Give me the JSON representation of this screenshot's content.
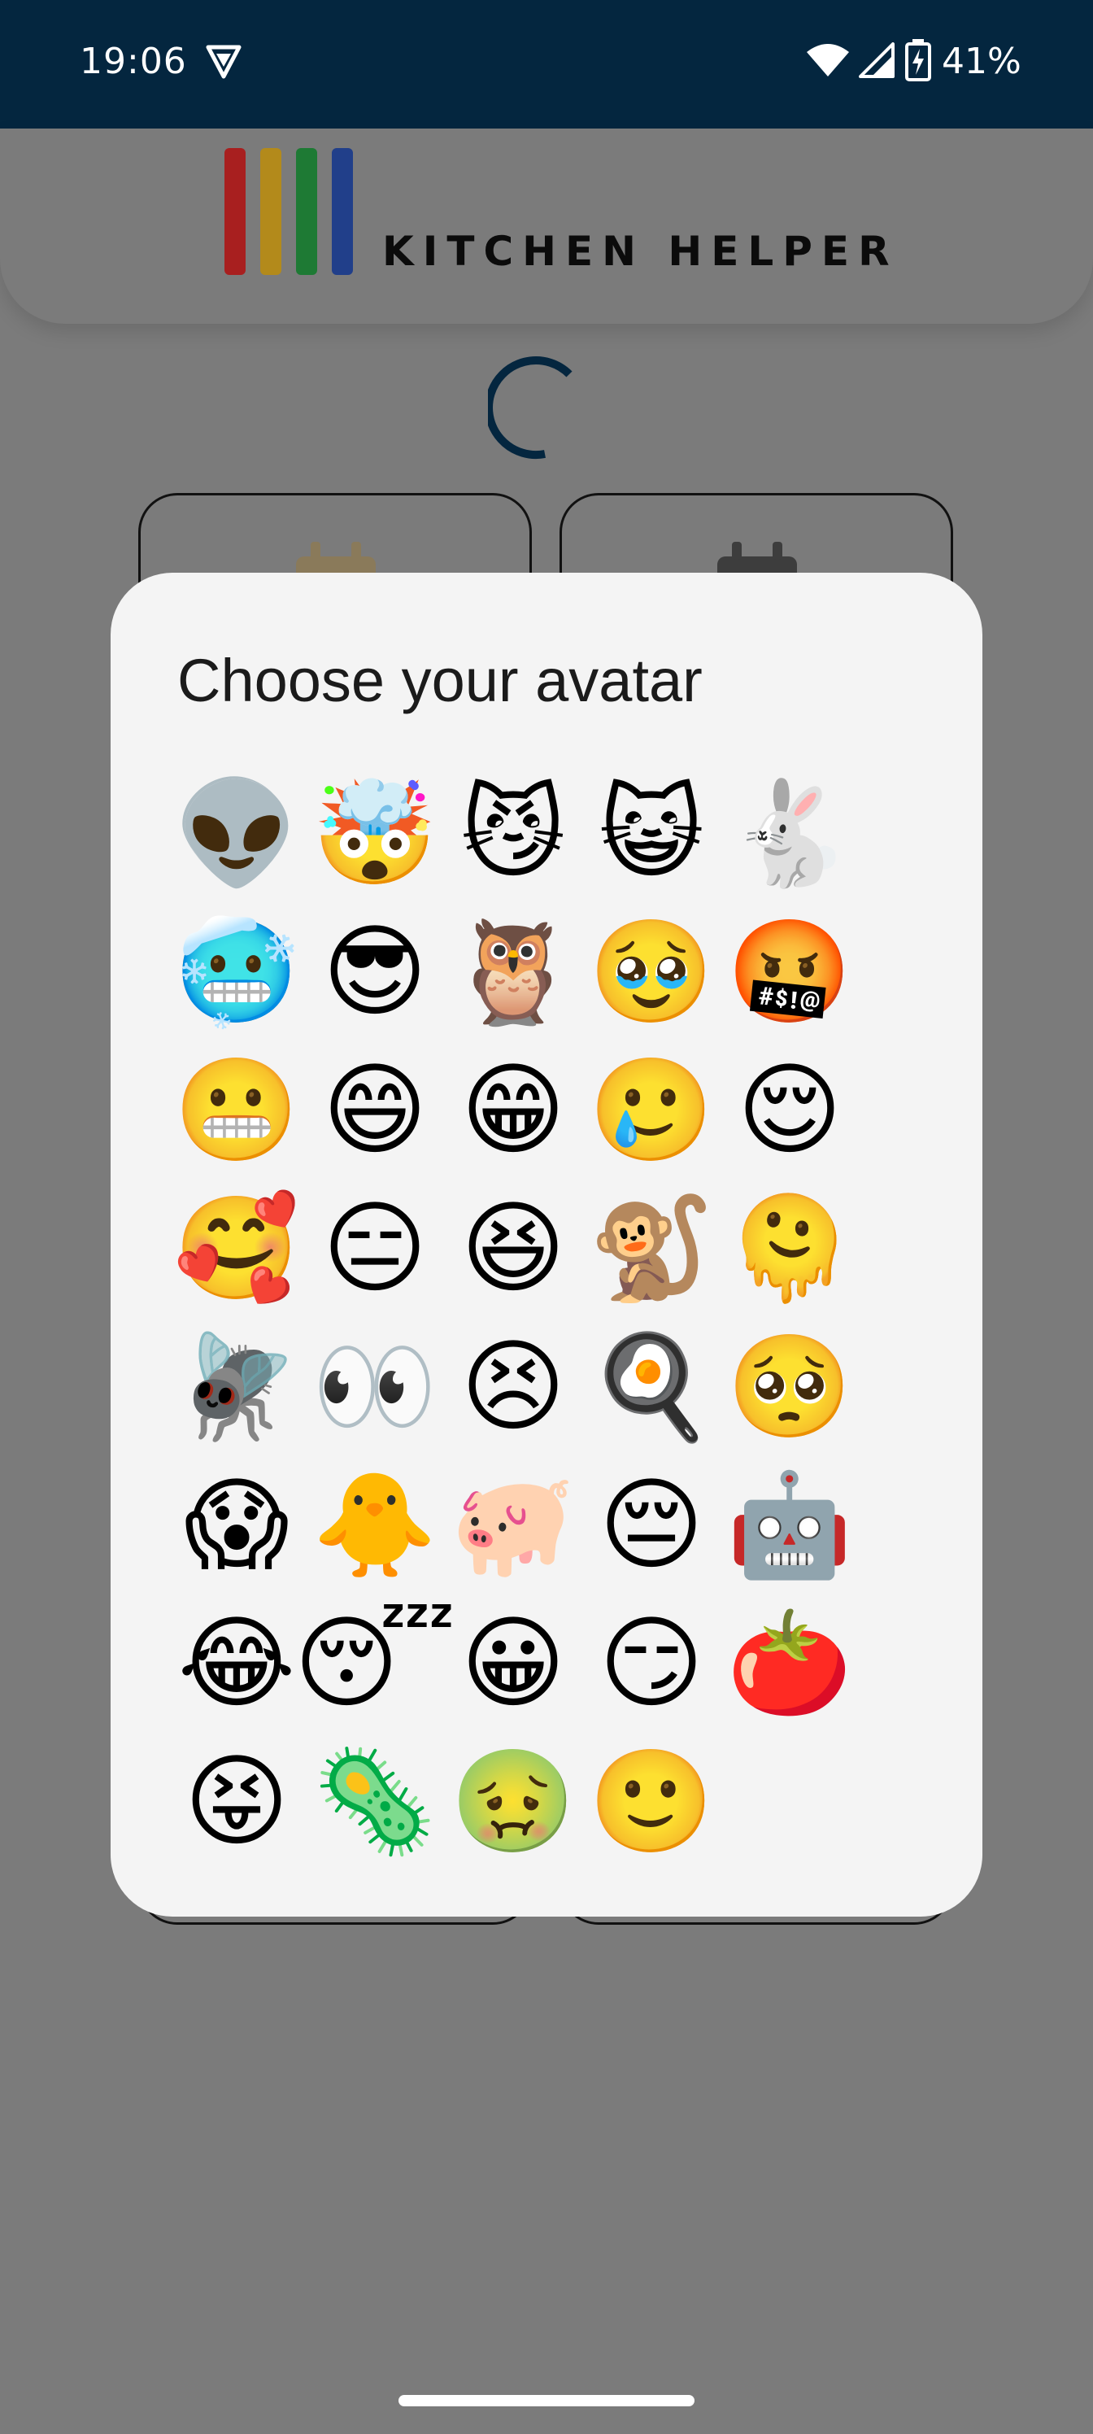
{
  "status_bar": {
    "time": "19:06",
    "battery": "41%",
    "icons": [
      "vpn-icon",
      "wifi-icon",
      "signal-icon",
      "battery-charging-icon"
    ]
  },
  "app": {
    "name": "KITCHEN HELPER",
    "logo_colors": [
      "#a81f1f",
      "#b38a1b",
      "#1e7a34",
      "#213f8a"
    ],
    "accent": "#04263f"
  },
  "dialog": {
    "title": "Choose your avatar",
    "avatars": [
      {
        "name": "alien",
        "emoji": "👽"
      },
      {
        "name": "exploding-head",
        "emoji": "🤯"
      },
      {
        "name": "smirking-cat",
        "emoji": "😼"
      },
      {
        "name": "grinning-cat",
        "emoji": "😺"
      },
      {
        "name": "rabbit",
        "emoji": "🐇"
      },
      {
        "name": "cold-face",
        "emoji": "🥶"
      },
      {
        "name": "cool-sunglasses",
        "emoji": "😎"
      },
      {
        "name": "owl",
        "emoji": "🦉"
      },
      {
        "name": "holding-back-tears",
        "emoji": "🥹"
      },
      {
        "name": "cursing-face",
        "emoji": "🤬"
      },
      {
        "name": "grimacing-face",
        "emoji": "😬"
      },
      {
        "name": "grinning-smiling-eyes",
        "emoji": "😄"
      },
      {
        "name": "beaming-face",
        "emoji": "😁"
      },
      {
        "name": "smiling-with-tear",
        "emoji": "🥲"
      },
      {
        "name": "relieved-sleepy",
        "emoji": "😌"
      },
      {
        "name": "smiling-hearts",
        "emoji": "🥰"
      },
      {
        "name": "expressionless",
        "emoji": "😑"
      },
      {
        "name": "squinting-laughing",
        "emoji": "😆"
      },
      {
        "name": "monkey",
        "emoji": "🐒"
      },
      {
        "name": "melting-face",
        "emoji": "🫠"
      },
      {
        "name": "fly",
        "emoji": "🪰"
      },
      {
        "name": "eyes",
        "emoji": "👀"
      },
      {
        "name": "persevering-face",
        "emoji": "😣"
      },
      {
        "name": "fried-egg",
        "emoji": "🍳"
      },
      {
        "name": "pleading-face",
        "emoji": "🥺"
      },
      {
        "name": "screaming-in-fear",
        "emoji": "😱"
      },
      {
        "name": "baby-chick",
        "emoji": "🐥"
      },
      {
        "name": "pig",
        "emoji": "🐖"
      },
      {
        "name": "pensive-face",
        "emoji": "😔"
      },
      {
        "name": "robot",
        "emoji": "🤖"
      },
      {
        "name": "tears-of-joy",
        "emoji": "😂"
      },
      {
        "name": "sleeping-face",
        "emoji": "😴"
      },
      {
        "name": "grinning-face",
        "emoji": "😀"
      },
      {
        "name": "smirking-face",
        "emoji": "😏"
      },
      {
        "name": "tomato",
        "emoji": "🍅"
      },
      {
        "name": "squinting-tongue",
        "emoji": "😝"
      },
      {
        "name": "microbe",
        "emoji": "🦠"
      },
      {
        "name": "nauseated-face",
        "emoji": "🤢"
      },
      {
        "name": "slightly-smiling-face",
        "emoji": "🙂"
      }
    ]
  }
}
